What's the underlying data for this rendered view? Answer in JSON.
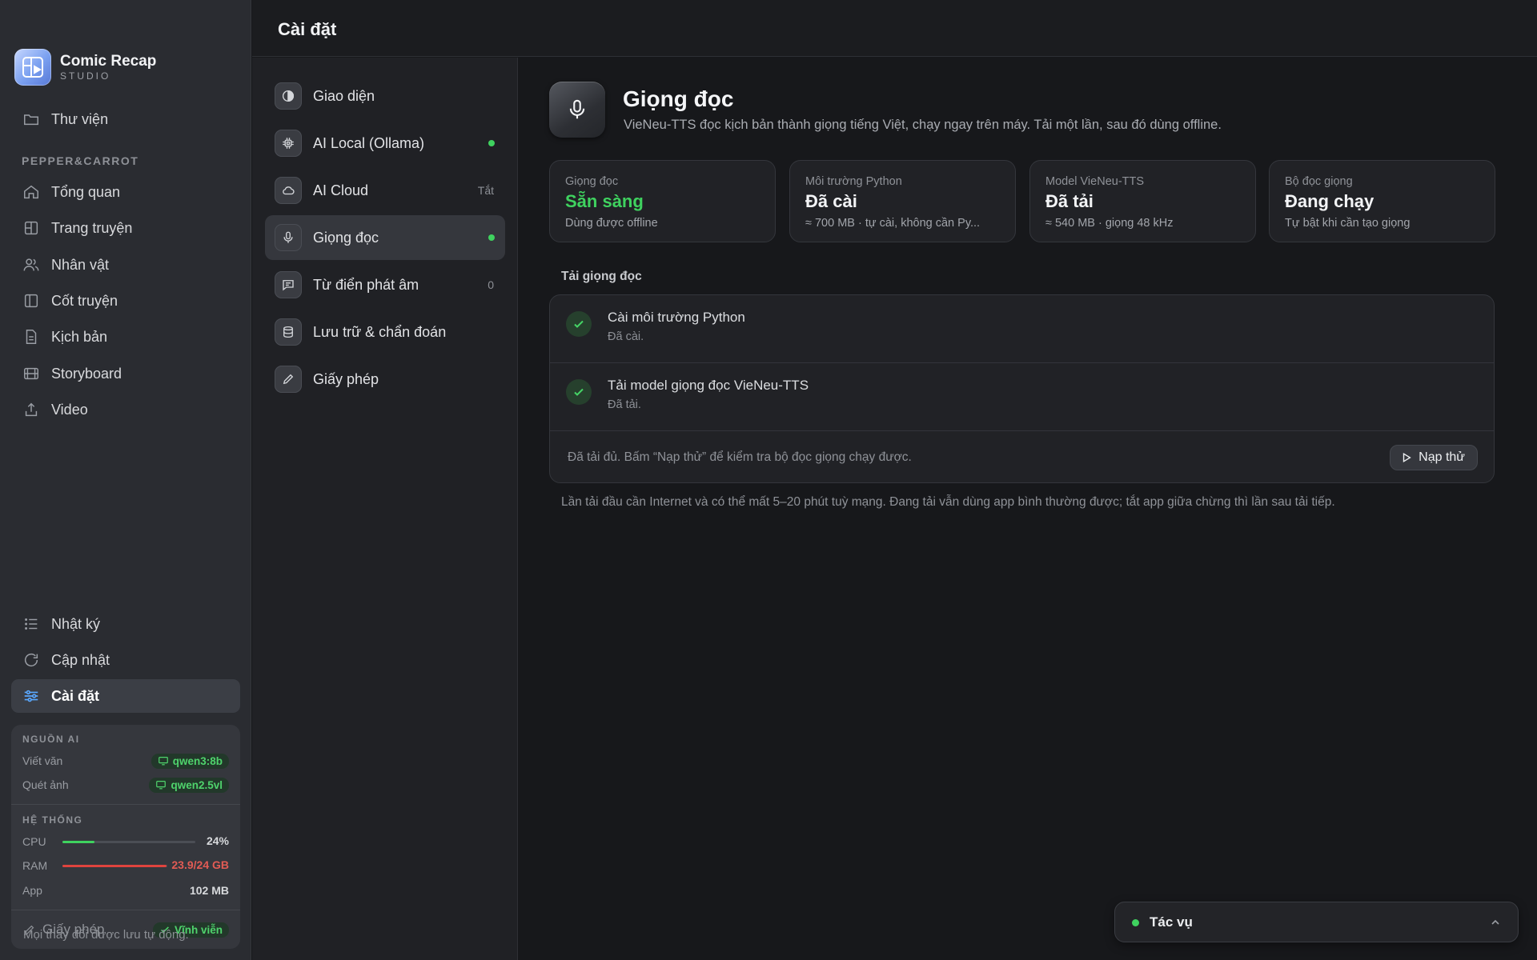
{
  "app": {
    "name": "Comic Recap",
    "subtitle": "STUDIO"
  },
  "sidebar": {
    "library": "Thư viện",
    "project_section": "PEPPER&CARROT",
    "items": [
      {
        "label": "Tổng quan",
        "icon": "home-icon"
      },
      {
        "label": "Trang truyện",
        "icon": "grid-icon"
      },
      {
        "label": "Nhân vật",
        "icon": "users-icon"
      },
      {
        "label": "Cốt truyện",
        "icon": "book-icon"
      },
      {
        "label": "Kịch bản",
        "icon": "document-icon"
      },
      {
        "label": "Storyboard",
        "icon": "film-icon"
      },
      {
        "label": "Video",
        "icon": "upload-icon"
      }
    ],
    "bottom_items": [
      {
        "label": "Nhật ký",
        "icon": "list-icon"
      },
      {
        "label": "Cập nhật",
        "icon": "refresh-icon"
      },
      {
        "label": "Cài đặt",
        "icon": "sliders-icon",
        "active": true
      }
    ],
    "status": {
      "ai_heading": "NGUỒN AI",
      "write_label": "Viết văn",
      "write_model": "qwen3:8b",
      "scan_label": "Quét ảnh",
      "scan_model": "qwen2.5vl",
      "system_heading": "HỆ THỐNG",
      "cpu_label": "CPU",
      "cpu_value": "24%",
      "cpu_fraction": 0.24,
      "ram_label": "RAM",
      "ram_value": "23.9/24 GB",
      "ram_fraction": 0.996,
      "app_label": "App",
      "app_value": "102 MB",
      "license_label": "Giấy phép",
      "license_value": "Vĩnh viễn"
    }
  },
  "topbar": {
    "title": "Cài đặt"
  },
  "settings_nav": {
    "items": [
      {
        "label": "Giao diện",
        "icon": "palette-icon",
        "right": ""
      },
      {
        "label": "AI Local (Ollama)",
        "icon": "cpu-icon",
        "right": "dot"
      },
      {
        "label": "AI Cloud",
        "icon": "cloud-icon",
        "right": "Tắt"
      },
      {
        "label": "Giọng đọc",
        "icon": "mic-icon",
        "right": "dot",
        "active": true
      },
      {
        "label": "Từ điển phát âm",
        "icon": "chat-icon",
        "right": "0"
      },
      {
        "label": "Lưu trữ & chẩn đoán",
        "icon": "database-icon",
        "right": ""
      },
      {
        "label": "Giấy phép",
        "icon": "pen-icon",
        "right": ""
      }
    ],
    "footer": "Mọi thay đổi được lưu tự động."
  },
  "main": {
    "title": "Giọng đọc",
    "description": "VieNeu-TTS đọc kịch bản thành giọng tiếng Việt, chạy ngay trên máy. Tải một lần, sau đó dùng offline.",
    "cards": [
      {
        "label": "Giọng đọc",
        "value": "Sẵn sàng",
        "sub": "Dùng được offline",
        "status_color": "#3fd25f"
      },
      {
        "label": "Môi trường Python",
        "value": "Đã cài",
        "sub": "≈ 700 MB · tự cài, không cần Py..."
      },
      {
        "label": "Model VieNeu-TTS",
        "value": "Đã tải",
        "sub": "≈ 540 MB · giọng 48 kHz"
      },
      {
        "label": "Bộ đọc giọng",
        "value": "Đang chạy",
        "sub": "Tự bật khi cần tạo giọng"
      }
    ],
    "download_section": "Tải giọng đọc",
    "steps": [
      {
        "title": "Cài môi trường Python",
        "status": "Đã cài."
      },
      {
        "title": "Tải model giọng đọc VieNeu-TTS",
        "status": "Đã tải."
      }
    ],
    "steps_footer": "Đã tải đủ. Bấm “Nạp thử” để kiểm tra bộ đọc giọng chạy được.",
    "try_button": "Nạp thử",
    "note": "Lần tải đầu cần Internet và có thể mất 5–20 phút tuỳ mạng. Đang tải vẫn dùng app bình thường được; tắt app giữa chừng thì lần sau tải tiếp."
  },
  "tasks": {
    "label": "Tác vụ"
  },
  "colors": {
    "accent_green": "#3fd25f",
    "ram_red": "#e0443e",
    "active_blue": "#5aa8ff"
  }
}
